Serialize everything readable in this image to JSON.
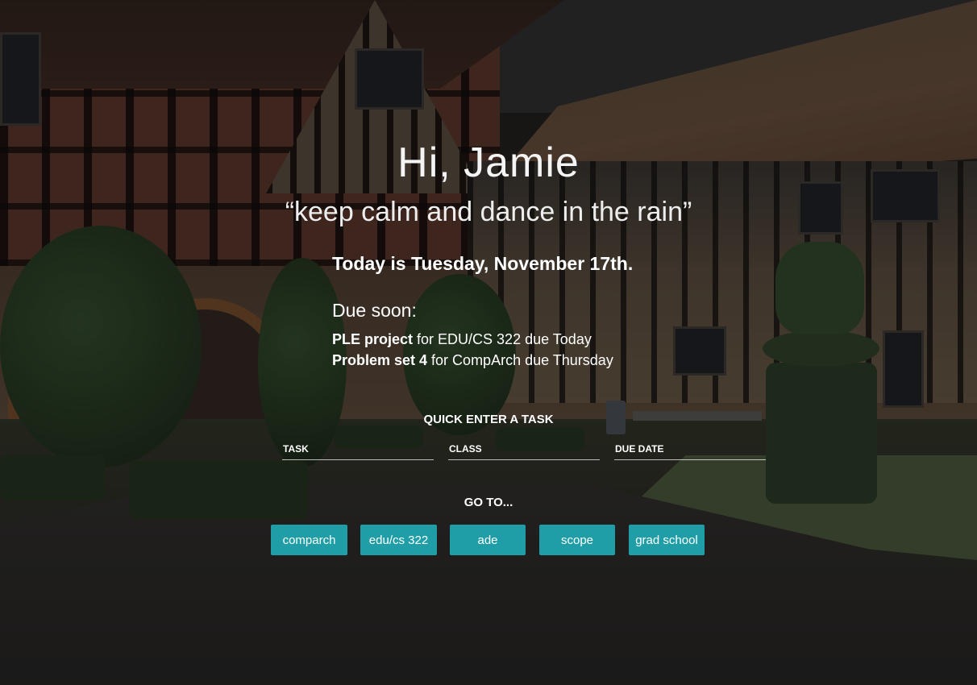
{
  "greeting": "Hi, Jamie",
  "quote": "“keep calm and dance in the rain”",
  "today": "Today is Tuesday, November 17th.",
  "due_soon": {
    "heading": "Due soon:",
    "items": [
      {
        "task": "PLE project",
        "rest": " for EDU/CS 322 due Today"
      },
      {
        "task": "Problem set 4",
        "rest": " for CompArch due Thursday"
      }
    ]
  },
  "quick_enter": {
    "title": "QUICK ENTER A TASK",
    "task_placeholder": "TASK",
    "class_placeholder": "CLASS",
    "due_date_placeholder": "DUE DATE"
  },
  "goto": {
    "title": "GO TO...",
    "links": [
      "comparch",
      "edu/cs 322",
      "ade",
      "scope",
      "grad school"
    ]
  },
  "colors": {
    "button": "#1f9ea8",
    "text": "#ffffff"
  }
}
